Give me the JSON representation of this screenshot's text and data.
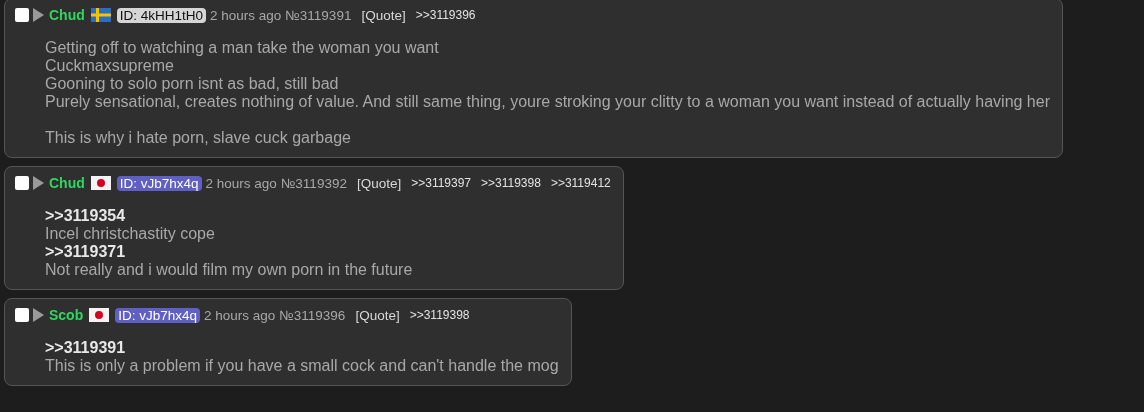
{
  "posts": [
    {
      "checked": false,
      "name": "Chud",
      "flag": {
        "kind": "sweden"
      },
      "id": {
        "label": "ID: 4kHH1tH0",
        "color": "#d6d6d6"
      },
      "time": "2 hours ago",
      "number": "№3119391",
      "quote": "[Quote]",
      "backlinks": [
        ">>3119396"
      ],
      "body": [
        {
          "kind": "text",
          "text": "Getting off to watching a man take the woman you want"
        },
        {
          "kind": "text",
          "text": "Cuckmaxsupreme"
        },
        {
          "kind": "text",
          "text": "Gooning to solo porn isnt as bad, still bad"
        },
        {
          "kind": "text",
          "text": "Purely sensational, creates nothing of value. And still same thing, youre stroking your clitty to a woman you want instead of actually having her"
        },
        {
          "kind": "gap"
        },
        {
          "kind": "text",
          "text": "This is why i hate porn, slave cuck garbage"
        }
      ]
    },
    {
      "checked": false,
      "name": "Chud",
      "flag": {
        "kind": "japan"
      },
      "id": {
        "label": "ID: vJb7hx4q",
        "color": "#5f5fc4"
      },
      "time": "2 hours ago",
      "number": "№3119392",
      "quote": "[Quote]",
      "backlinks": [
        ">>3119397",
        ">>3119398",
        ">>3119412"
      ],
      "body": [
        {
          "kind": "link",
          "text": ">>3119354"
        },
        {
          "kind": "text",
          "text": "Incel christchastity cope"
        },
        {
          "kind": "link",
          "text": ">>3119371"
        },
        {
          "kind": "text",
          "text": "Not really and i would film my own porn in the future"
        }
      ]
    },
    {
      "checked": false,
      "name": "Scob",
      "flag": {
        "kind": "japan"
      },
      "id": {
        "label": "ID: vJb7hx4q",
        "color": "#5f5fc4"
      },
      "time": "2 hours ago",
      "number": "№3119396",
      "quote": "[Quote]",
      "backlinks": [
        ">>3119398"
      ],
      "body": [
        {
          "kind": "link",
          "text": ">>3119391"
        },
        {
          "kind": "text",
          "text": "This is only a problem if you have a small cock and can't handle the mog"
        }
      ]
    }
  ]
}
